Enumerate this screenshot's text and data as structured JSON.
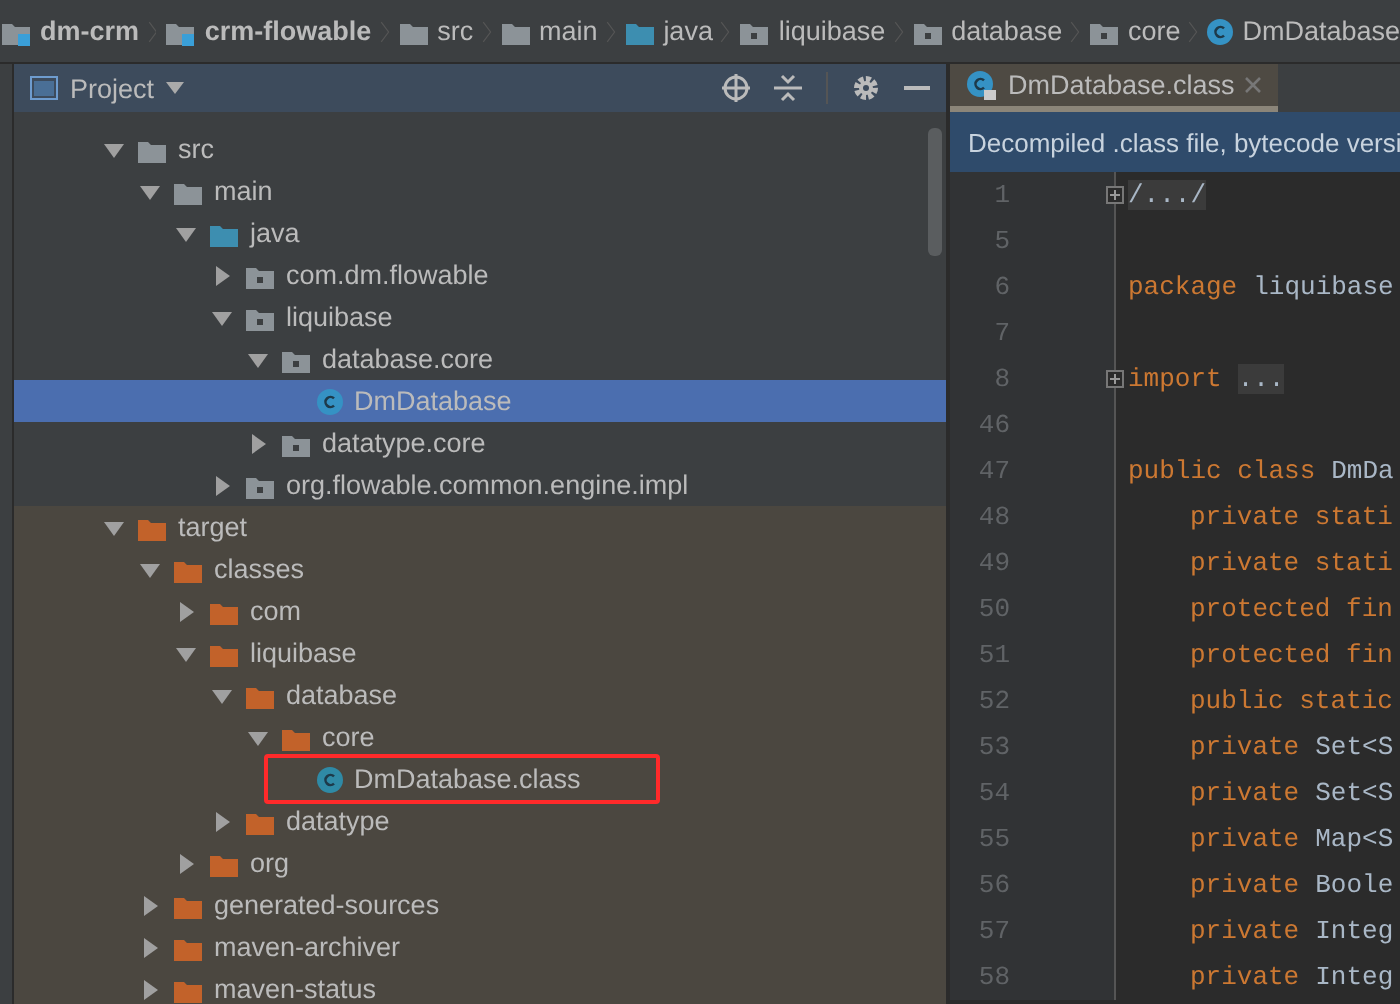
{
  "breadcrumb": [
    {
      "label": "dm-crm",
      "kind": "module"
    },
    {
      "label": "crm-flowable",
      "kind": "module"
    },
    {
      "label": "src",
      "kind": "folder"
    },
    {
      "label": "main",
      "kind": "folder"
    },
    {
      "label": "java",
      "kind": "source-folder"
    },
    {
      "label": "liquibase",
      "kind": "package"
    },
    {
      "label": "database",
      "kind": "package"
    },
    {
      "label": "core",
      "kind": "package"
    },
    {
      "label": "DmDatabase",
      "kind": "class"
    }
  ],
  "project_panel": {
    "title": "Project",
    "tree": [
      {
        "label": "src",
        "kind": "folder",
        "expanded": true,
        "selected": false,
        "children": [
          {
            "label": "main",
            "kind": "folder",
            "expanded": true,
            "selected": false,
            "children": [
              {
                "label": "java",
                "kind": "source-folder",
                "expanded": true,
                "selected": false,
                "children": [
                  {
                    "label": "com.dm.flowable",
                    "kind": "package",
                    "expanded": false,
                    "selected": false
                  },
                  {
                    "label": "liquibase",
                    "kind": "package",
                    "expanded": true,
                    "selected": false,
                    "children": [
                      {
                        "label": "database.core",
                        "kind": "package",
                        "expanded": true,
                        "selected": false,
                        "children": [
                          {
                            "label": "DmDatabase",
                            "kind": "class",
                            "selected": true
                          }
                        ]
                      },
                      {
                        "label": "datatype.core",
                        "kind": "package",
                        "expanded": false,
                        "selected": false
                      }
                    ]
                  },
                  {
                    "label": "org.flowable.common.engine.impl",
                    "kind": "package",
                    "expanded": false,
                    "selected": false
                  }
                ]
              }
            ]
          }
        ]
      },
      {
        "label": "target",
        "kind": "excluded-folder",
        "expanded": true,
        "selected": false,
        "children": [
          {
            "label": "classes",
            "kind": "excluded-folder",
            "expanded": true,
            "selected": false,
            "children": [
              {
                "label": "com",
                "kind": "excluded-folder",
                "expanded": false,
                "selected": false
              },
              {
                "label": "liquibase",
                "kind": "excluded-folder",
                "expanded": true,
                "selected": false,
                "children": [
                  {
                    "label": "database",
                    "kind": "excluded-folder",
                    "expanded": true,
                    "selected": false,
                    "children": [
                      {
                        "label": "core",
                        "kind": "excluded-folder",
                        "expanded": true,
                        "selected": false,
                        "children": [
                          {
                            "label": "DmDatabase.class",
                            "kind": "compiled-class",
                            "selected": false,
                            "highlighted": true
                          }
                        ]
                      }
                    ]
                  },
                  {
                    "label": "datatype",
                    "kind": "excluded-folder",
                    "expanded": false,
                    "selected": false
                  }
                ]
              },
              {
                "label": "org",
                "kind": "excluded-folder",
                "expanded": false,
                "selected": false
              }
            ]
          },
          {
            "label": "generated-sources",
            "kind": "excluded-folder",
            "expanded": false,
            "selected": false
          },
          {
            "label": "maven-archiver",
            "kind": "excluded-folder",
            "expanded": false,
            "selected": false
          },
          {
            "label": "maven-status",
            "kind": "excluded-folder",
            "expanded": false,
            "selected": false
          }
        ]
      }
    ]
  },
  "editor": {
    "tab": {
      "label": "DmDatabase.class",
      "selected": true
    },
    "banner": "Decompiled .class file, bytecode versi",
    "lines": [
      {
        "number": "1",
        "folded": true,
        "tokens": [
          {
            "text": "/.../",
            "kind": "fold"
          }
        ]
      },
      {
        "number": "5"
      },
      {
        "number": "6",
        "tokens": [
          {
            "text": "package",
            "kind": "keyword"
          },
          {
            "text": "liquibase",
            "kind": "plain"
          }
        ]
      },
      {
        "number": "7"
      },
      {
        "number": "8",
        "folded": true,
        "tokens": [
          {
            "text": "import",
            "kind": "keyword"
          },
          {
            "text": "...",
            "kind": "fold"
          }
        ]
      },
      {
        "number": "46"
      },
      {
        "number": "47",
        "tokens": [
          {
            "text": "public class",
            "kind": "keyword"
          },
          {
            "text": "DmDa",
            "kind": "plain"
          }
        ],
        "children": [
          {
            "number": "48",
            "tokens": [
              {
                "text": "private stati",
                "kind": "keyword"
              }
            ]
          },
          {
            "number": "49",
            "tokens": [
              {
                "text": "private stati",
                "kind": "keyword"
              }
            ]
          },
          {
            "number": "50",
            "tokens": [
              {
                "text": "protected fin",
                "kind": "keyword"
              }
            ]
          },
          {
            "number": "51",
            "tokens": [
              {
                "text": "protected fin",
                "kind": "keyword"
              }
            ]
          },
          {
            "number": "52",
            "tokens": [
              {
                "text": "public static",
                "kind": "keyword"
              }
            ]
          },
          {
            "number": "53",
            "tokens": [
              {
                "text": "private",
                "kind": "keyword"
              },
              {
                "text": "Set<S",
                "kind": "plain"
              }
            ]
          },
          {
            "number": "54",
            "tokens": [
              {
                "text": "private",
                "kind": "keyword"
              },
              {
                "text": "Set<S",
                "kind": "plain"
              }
            ]
          },
          {
            "number": "55",
            "tokens": [
              {
                "text": "private",
                "kind": "keyword"
              },
              {
                "text": "Map<S",
                "kind": "plain"
              }
            ]
          },
          {
            "number": "56",
            "tokens": [
              {
                "text": "private",
                "kind": "keyword"
              },
              {
                "text": "Boole",
                "kind": "plain"
              }
            ]
          },
          {
            "number": "57",
            "tokens": [
              {
                "text": "private",
                "kind": "keyword"
              },
              {
                "text": "Integ",
                "kind": "plain"
              }
            ]
          },
          {
            "number": "58",
            "tokens": [
              {
                "text": "private",
                "kind": "keyword"
              },
              {
                "text": "Integ",
                "kind": "plain"
              }
            ]
          }
        ]
      }
    ]
  }
}
